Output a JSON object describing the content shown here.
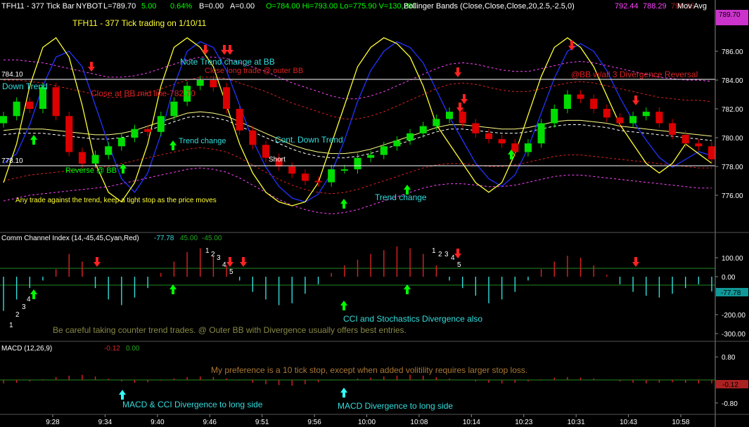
{
  "header": {
    "symbol": "TFH11 - 377 Tick Bar",
    "exchange": "NYBOT",
    "last": "L=789.70",
    "change": "5.00",
    "pct": "0.64%",
    "bid": "B=0.00",
    "ask": "A=0.00",
    "ohlc": "O=784.00  Hi=793.00  Lo=775.90  V=130,290",
    "bb_label": "Bollinger Bands (Close,Close,Close,20,2.5,-2.5,0)",
    "bb_upper": "792.44",
    "bb_mid": "788.29",
    "bb_lower": "790.36",
    "mov_avg": "Mov Avg",
    "last_price_tag": "789.70"
  },
  "colors": {
    "background": "#000000",
    "up_bar": "#00dd00",
    "down_bar": "#dd0000",
    "bb_outer": "#ff44ff",
    "bb_inner": "#dd2222",
    "stoch_k": "#ffff33",
    "stoch_d": "#2233ff",
    "mid_line": "#ffffff",
    "cci_pos": "#dd2222",
    "cci_neg": "#33dddd",
    "arrow_up": "#00ff00",
    "arrow_down": "#ff2222",
    "macd_arrow": "#33ffff"
  },
  "annotations": {
    "title": "TFH11 - 377 Tick trading on 1/10/11",
    "note_trend": "Note Trend change at BB",
    "close_long": "Close long trade @ outer BB",
    "close_mid": "Close at BB mid line-782.70",
    "down_trend": "Down Trend",
    "reverse": "Reverse @ BB",
    "trend_change1": "Trend change",
    "cont_down": "Cont. Down Trend",
    "short": "Short",
    "trend_change2": "Trend change",
    "divergence": "@BB w/all 3 Divergence Reversal",
    "any_trade": "Any trade against the trend, keep a tight stop as the price moves",
    "level_784": "784.10",
    "level_778": "778.10",
    "cci_div": "CCI and Stochastics Divergence also",
    "careful": "Be careful taking counter trend trades.  @ Outer BB with Divergence usually offers best entries.",
    "preference": "My preference is a 10 tick stop, except when added volitility requires larger stop loss.",
    "macd_cci_div": "MACD & CCI Divergence to long side",
    "macd_div": "MACD Divergence to long side",
    "n1": "1",
    "n2": "2",
    "n3": "3",
    "n4": "4",
    "n5": "5"
  },
  "cci_panel": {
    "label": "Comm Channel Index (14,-45,45,Cyan,Red)",
    "value": "-77.78",
    "upper": "45.00",
    "lower": "-45.00",
    "value_tag": "-77.78"
  },
  "macd_panel": {
    "label": "MACD (12,26,9)",
    "value": "-0.12",
    "signal": "0.00",
    "value_tag": "-0.12"
  },
  "price_axis": [
    "786.00",
    "784.00",
    "782.00",
    "780.00",
    "778.00",
    "776.00"
  ],
  "cci_axis": [
    "100.00",
    "0.00",
    "-200.00",
    "-300.00"
  ],
  "macd_axis": [
    "0.80",
    "-0.80"
  ],
  "time_axis": [
    "9:28",
    "9:34",
    "9:40",
    "9:46",
    "9:51",
    "9:56",
    "10:00",
    "10:08",
    "10:14",
    "10:23",
    "10:31",
    "10:43",
    "10:58"
  ],
  "chart_data": {
    "type": "candlestick",
    "price_ylim": [
      774.0,
      788.0
    ],
    "bb_upper": [
      784.0,
      784.0,
      783.9,
      783.8,
      783.6,
      783.4,
      783.2,
      783.0,
      782.8,
      782.8,
      782.9,
      783.1,
      783.4,
      783.7,
      784.0,
      784.2,
      784.2,
      784.1,
      783.8,
      783.5,
      783.2,
      782.8,
      782.4,
      782.1,
      781.8,
      781.5,
      781.3,
      781.3,
      781.5,
      781.8,
      782.2,
      782.6,
      783.0,
      783.4,
      783.7,
      783.8,
      783.7,
      783.5,
      783.3,
      783.2,
      783.2,
      783.4,
      783.6,
      783.8,
      783.9,
      783.8,
      783.6,
      783.4,
      783.2,
      783.0,
      782.8,
      782.7,
      782.6,
      782.6,
      782.5
    ],
    "bb_lower": [
      777.0,
      777.2,
      777.4,
      777.5,
      777.6,
      777.7,
      777.8,
      777.9,
      778.0,
      778.2,
      778.4,
      778.6,
      778.8,
      779.0,
      779.2,
      779.3,
      779.2,
      779.0,
      778.6,
      778.1,
      777.6,
      777.1,
      776.7,
      776.4,
      776.2,
      776.1,
      776.2,
      776.4,
      776.7,
      777.0,
      777.3,
      777.6,
      777.9,
      778.1,
      778.2,
      778.2,
      778.1,
      778.0,
      778.0,
      778.1,
      778.3,
      778.5,
      778.7,
      778.8,
      778.8,
      778.7,
      778.6,
      778.5,
      778.4,
      778.3,
      778.2,
      778.1,
      778.0,
      777.9,
      777.9
    ],
    "bb_mid": [
      780.5,
      780.6,
      780.6,
      780.6,
      780.5,
      780.4,
      780.3,
      780.2,
      780.2,
      780.3,
      780.5,
      780.8,
      781.1,
      781.4,
      781.7,
      781.8,
      781.7,
      781.5,
      781.1,
      780.7,
      780.3,
      779.9,
      779.5,
      779.2,
      779.0,
      778.9,
      778.9,
      779.0,
      779.2,
      779.5,
      779.8,
      780.1,
      780.4,
      780.7,
      780.9,
      780.9,
      780.8,
      780.7,
      780.6,
      780.6,
      780.7,
      780.9,
      781.1,
      781.2,
      781.2,
      781.1,
      781.0,
      780.8,
      780.7,
      780.6,
      780.5,
      780.4,
      780.3,
      780.2,
      780.1
    ],
    "closes": [
      781.5,
      782.5,
      782.0,
      783.5,
      781.5,
      779.0,
      778.2,
      778.8,
      779.4,
      780.0,
      780.6,
      780.4,
      781.5,
      782.5,
      783.6,
      784.0,
      783.5,
      782.0,
      780.5,
      779.5,
      778.6,
      778.0,
      777.5,
      777.0,
      776.9,
      777.8,
      777.8,
      778.6,
      778.8,
      779.4,
      779.8,
      780.3,
      780.8,
      781.3,
      781.8,
      781.0,
      780.3,
      779.9,
      779.6,
      779.0,
      779.6,
      781.0,
      782.0,
      783.0,
      782.7,
      782.0,
      781.4,
      781.0,
      781.5,
      781.8,
      781.0,
      780.2,
      779.6,
      779.4,
      778.5
    ],
    "cci_values": [
      -180,
      -120,
      -60,
      -20,
      40,
      120,
      80,
      -60,
      -120,
      -150,
      -110,
      -60,
      20,
      80,
      130,
      150,
      110,
      60,
      -20,
      -80,
      -120,
      -150,
      -140,
      -90,
      -40,
      20,
      60,
      90,
      120,
      140,
      160,
      150,
      120,
      60,
      -20,
      -60,
      -100,
      -140,
      -120,
      -80,
      -20,
      40,
      80,
      110,
      100,
      60,
      10,
      -40,
      -80,
      -100,
      -110,
      -90,
      -60,
      -40,
      -77.78
    ],
    "macd_values": [
      -0.12,
      -0.1,
      -0.05,
      0.02,
      0.1,
      0.15,
      0.18,
      0.12,
      0.04,
      -0.05,
      -0.1,
      -0.08,
      -0.02,
      0.05,
      0.1,
      0.12,
      0.1,
      0.05,
      -0.02,
      -0.1,
      -0.15,
      -0.18,
      -0.2,
      -0.15,
      -0.08,
      -0.02,
      0.02,
      0.05,
      0.08,
      0.12,
      0.15,
      0.18,
      0.15,
      0.1,
      0.05,
      0.0,
      -0.05,
      -0.1,
      -0.12,
      -0.1,
      -0.05,
      0.02,
      0.08,
      0.1,
      0.08,
      0.05,
      0.0,
      -0.05,
      -0.1,
      -0.12,
      -0.1,
      -0.08,
      -0.1,
      -0.12,
      -0.12
    ],
    "stoch_k": [
      20,
      40,
      70,
      90,
      95,
      85,
      60,
      30,
      15,
      10,
      20,
      40,
      70,
      90,
      95,
      90,
      80,
      60,
      40,
      25,
      15,
      10,
      8,
      10,
      20,
      40,
      60,
      80,
      90,
      95,
      92,
      85,
      70,
      50,
      40,
      30,
      20,
      15,
      20,
      35,
      55,
      75,
      90,
      95,
      90,
      80,
      65,
      50,
      40,
      30,
      25,
      30,
      40,
      35,
      30
    ],
    "stoch_d": [
      30,
      35,
      50,
      70,
      85,
      88,
      80,
      60,
      40,
      22,
      15,
      25,
      45,
      70,
      88,
      93,
      90,
      78,
      60,
      42,
      28,
      18,
      12,
      10,
      14,
      25,
      42,
      62,
      78,
      88,
      93,
      90,
      82,
      68,
      54,
      42,
      30,
      22,
      18,
      24,
      38,
      56,
      74,
      88,
      92,
      88,
      78,
      64,
      52,
      42,
      33,
      28,
      32,
      36,
      34
    ]
  }
}
